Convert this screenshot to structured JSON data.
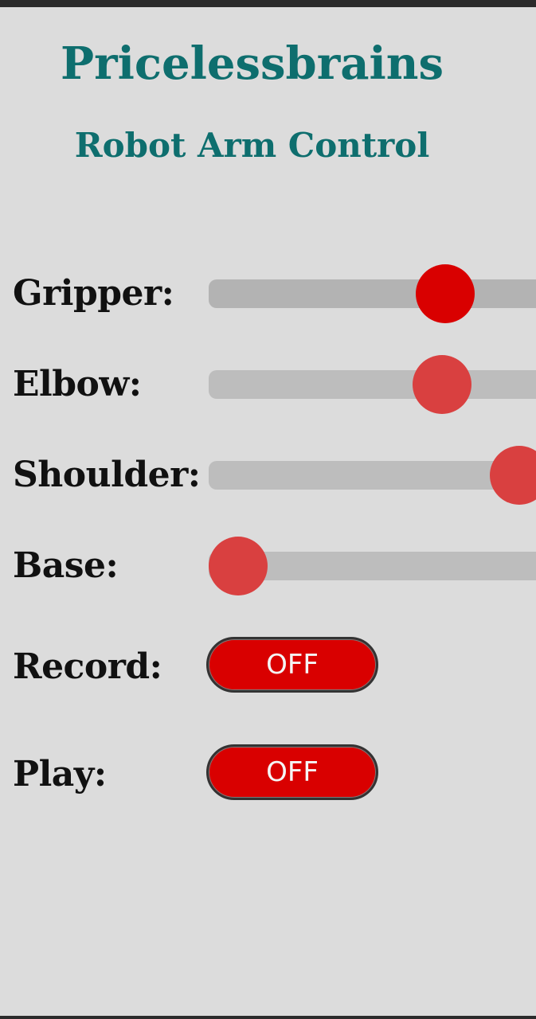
{
  "header": {
    "title": "Pricelessbrains",
    "subtitle": "Robot Arm Control"
  },
  "sliders": [
    {
      "id": "gripper",
      "label": "Gripper:",
      "level": 0.62,
      "focused": true
    },
    {
      "id": "elbow",
      "label": "Elbow:",
      "level": 0.61,
      "focused": false
    },
    {
      "id": "shoulder",
      "label": "Shoulder:",
      "level": 0.84,
      "focused": false
    },
    {
      "id": "base",
      "label": "Base:",
      "level": 0.0,
      "focused": false
    }
  ],
  "toggles": [
    {
      "id": "record",
      "label": "Record:",
      "state": "OFF"
    },
    {
      "id": "play",
      "label": "Play:",
      "state": "OFF"
    }
  ],
  "colors": {
    "accent": "#d90000",
    "thumb": "#d94040",
    "title": "#0e6e6e",
    "background": "#dcdcdc",
    "track": "#bdbdbd"
  }
}
